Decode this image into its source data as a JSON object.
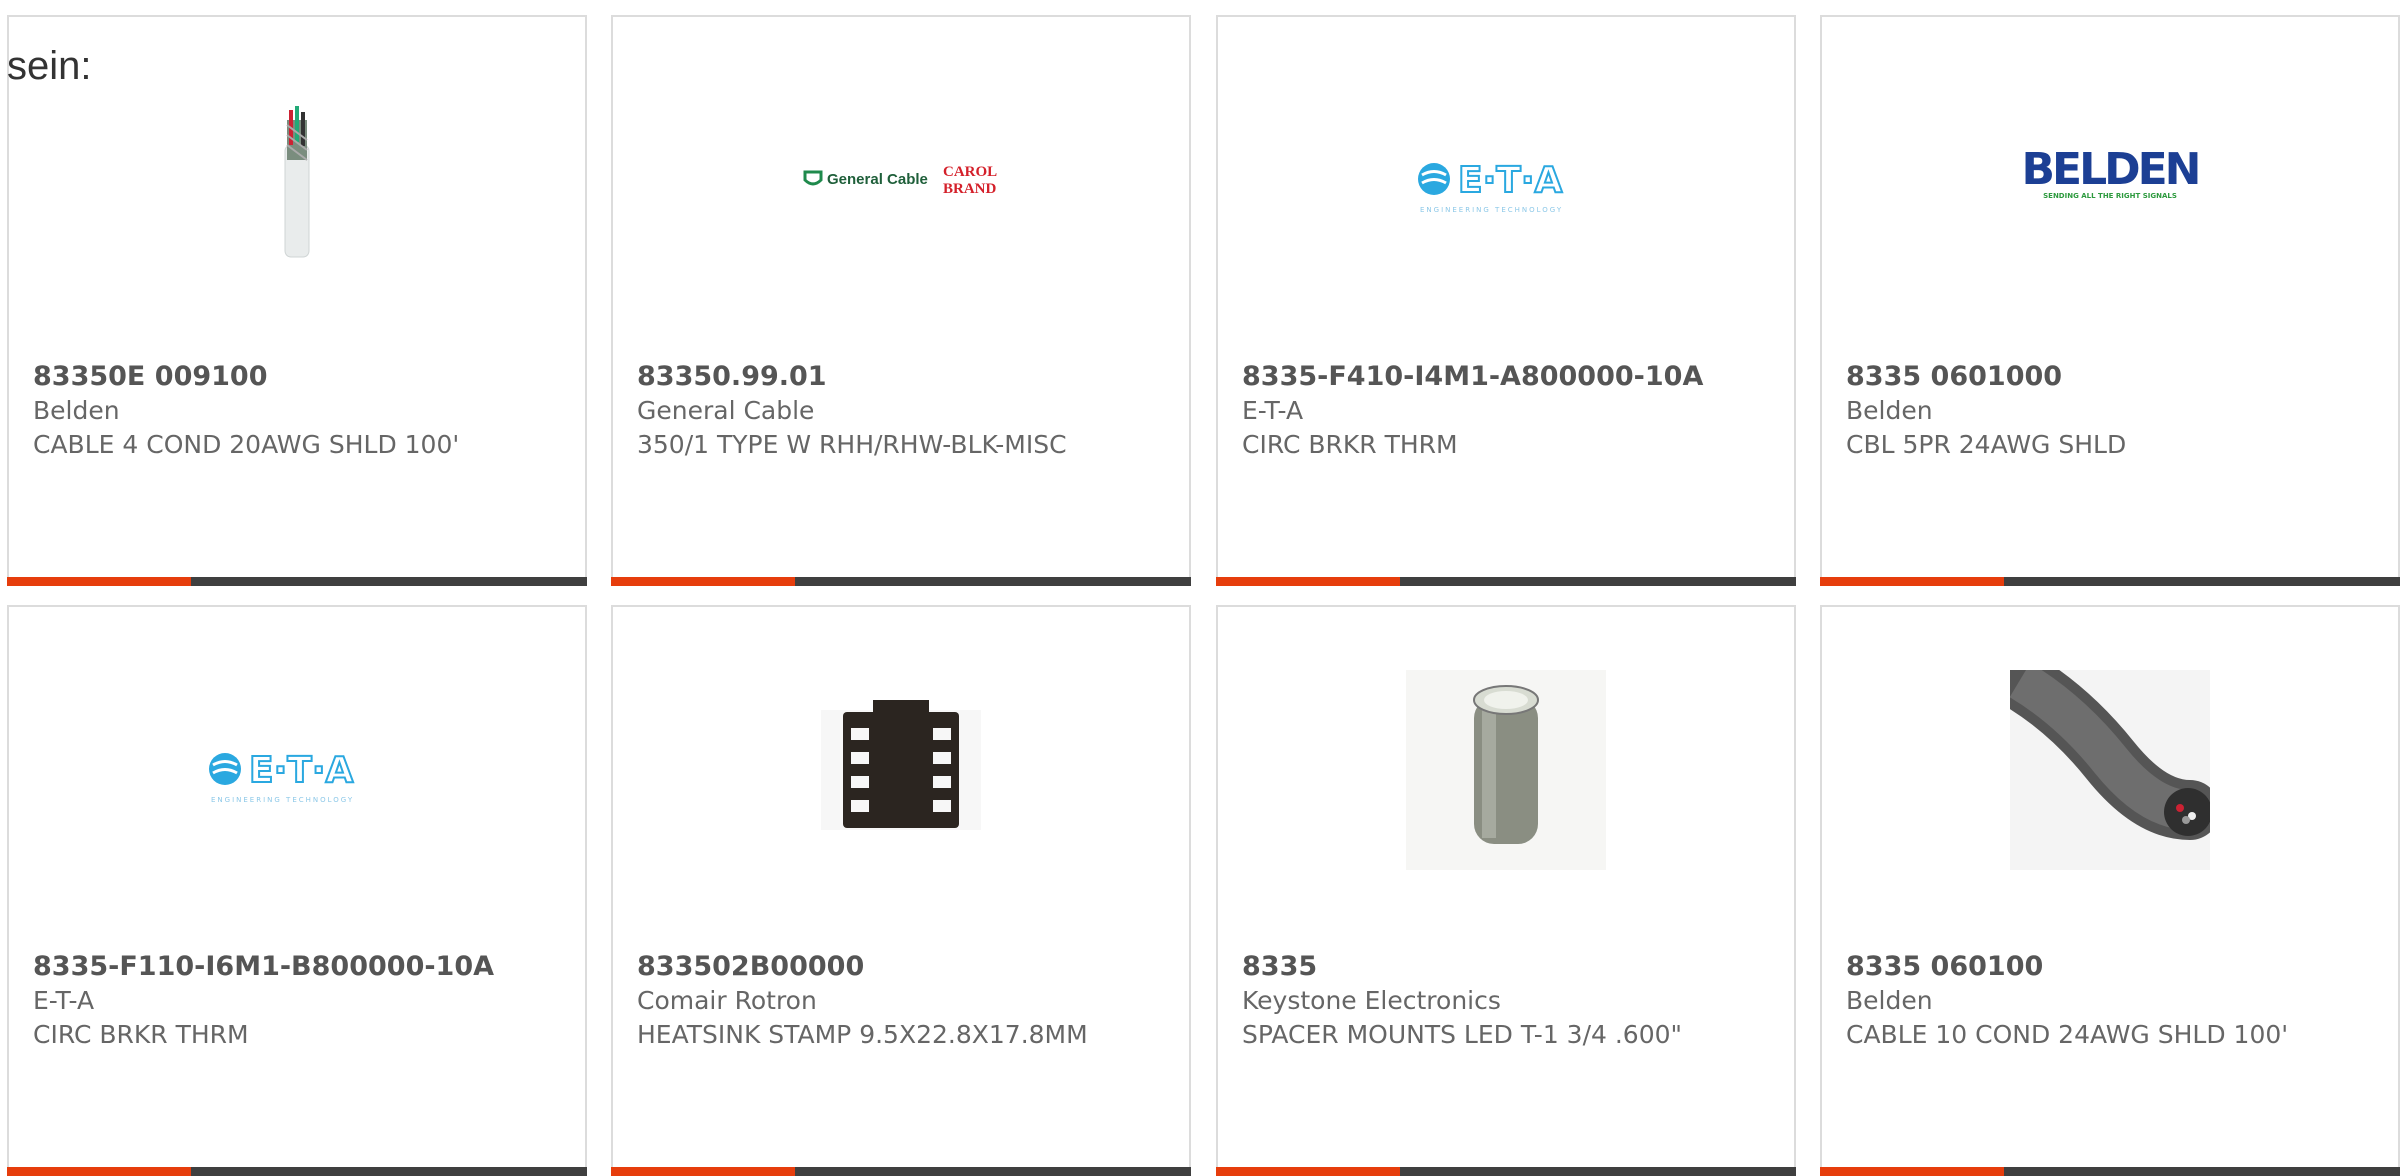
{
  "lead_text": "sein:",
  "products": [
    {
      "part_number": "83350E 009100",
      "manufacturer": "Belden",
      "description": "CABLE 4 COND 20AWG SHLD 100'",
      "image": "cable-spool-thumbnail"
    },
    {
      "part_number": "83350.99.01",
      "manufacturer": "General Cable",
      "description": "350/1 TYPE W RHH/RHW-BLK-MISC",
      "image": "general-cable-logo",
      "logo_text": "General Cable",
      "logo_text2": "CAROL",
      "logo_text3": "BRAND"
    },
    {
      "part_number": "8335-F410-I4M1-A800000-10A",
      "manufacturer": "E-T-A",
      "description": "CIRC BRKR THRM",
      "image": "eta-logo",
      "logo_text": "E·T·A",
      "logo_sub": "ENGINEERING TECHNOLOGY"
    },
    {
      "part_number": "8335 0601000",
      "manufacturer": "Belden",
      "description": "CBL 5PR 24AWG SHLD",
      "image": "belden-logo",
      "logo_text": "BELDEN",
      "logo_sub": "SENDING ALL THE RIGHT SIGNALS"
    },
    {
      "part_number": "8335-F110-I6M1-B800000-10A",
      "manufacturer": "E-T-A",
      "description": "CIRC BRKR THRM",
      "image": "eta-logo",
      "logo_text": "E·T·A",
      "logo_sub": "ENGINEERING TECHNOLOGY"
    },
    {
      "part_number": "833502B00000",
      "manufacturer": "Comair Rotron",
      "description": "HEATSINK STAMP 9.5X22.8X17.8MM",
      "image": "heatsink-thumbnail"
    },
    {
      "part_number": "8335",
      "manufacturer": "Keystone Electronics",
      "description": "SPACER MOUNTS LED T-1 3/4 .600\"",
      "image": "spacer-thumbnail"
    },
    {
      "part_number": "8335 060100",
      "manufacturer": "Belden",
      "description": "CABLE 10 COND 24AWG SHLD 100'",
      "image": "cable-coil-thumbnail"
    }
  ],
  "colors": {
    "accent": "#e63d0c",
    "bar": "#3f3f3f",
    "border": "#dcdcdc",
    "eta_blue": "#2aa8e0",
    "belden_blue": "#1c3f94",
    "belden_green": "#2d9a3e",
    "gc_green": "#1f8a4c",
    "carol_red": "#d4202a"
  }
}
